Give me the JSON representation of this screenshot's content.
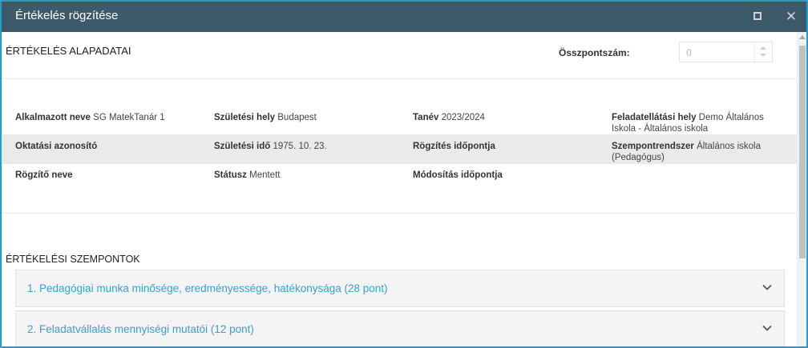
{
  "window": {
    "title": "Értékelés rögzítése",
    "maximize_icon": "maximize-icon",
    "close_glyph": "✕"
  },
  "base_section": {
    "title": "ÉRTÉKELÉS ALAPADATAI",
    "score_label": "Összpontszám:",
    "score_value": "0"
  },
  "info": {
    "rows": [
      [
        {
          "label": "Alkalmazott neve",
          "value": "SG MatekTanár 1"
        },
        {
          "label": "Születési hely",
          "value": "Budapest"
        },
        {
          "label": "Tanév",
          "value": "2023/2024"
        },
        {
          "label": "Feladatellátási hely",
          "value": "Demo Általános Iskola - Általános iskola"
        }
      ],
      [
        {
          "label": "Oktatási azonosító",
          "value": ""
        },
        {
          "label": "Születési idő",
          "value": "1975. 10. 23."
        },
        {
          "label": "Rögzítés időpontja",
          "value": ""
        },
        {
          "label": "Szempontrendszer",
          "value": "Általános iskola (Pedagógus)"
        }
      ],
      [
        {
          "label": "Rögzítő neve",
          "value": ""
        },
        {
          "label": "Státusz",
          "value": "Mentett"
        },
        {
          "label": "Módosítás időpontja",
          "value": ""
        },
        {
          "label": "",
          "value": ""
        }
      ]
    ]
  },
  "criteria_section": {
    "title": "ÉRTÉKELÉSI SZEMPONTOK",
    "items": [
      {
        "label": "1. Pedagógiai munka minősége, eredményessége, hatékonysága (28 pont)"
      },
      {
        "label": "2. Feladatvállalás mennyiségi mutatói (12 pont)"
      }
    ]
  },
  "colors": {
    "titlebar": "#3d5a6b",
    "border": "#1f9ed0",
    "link": "#3aa0cf",
    "row_shade": "#eaeaea"
  }
}
